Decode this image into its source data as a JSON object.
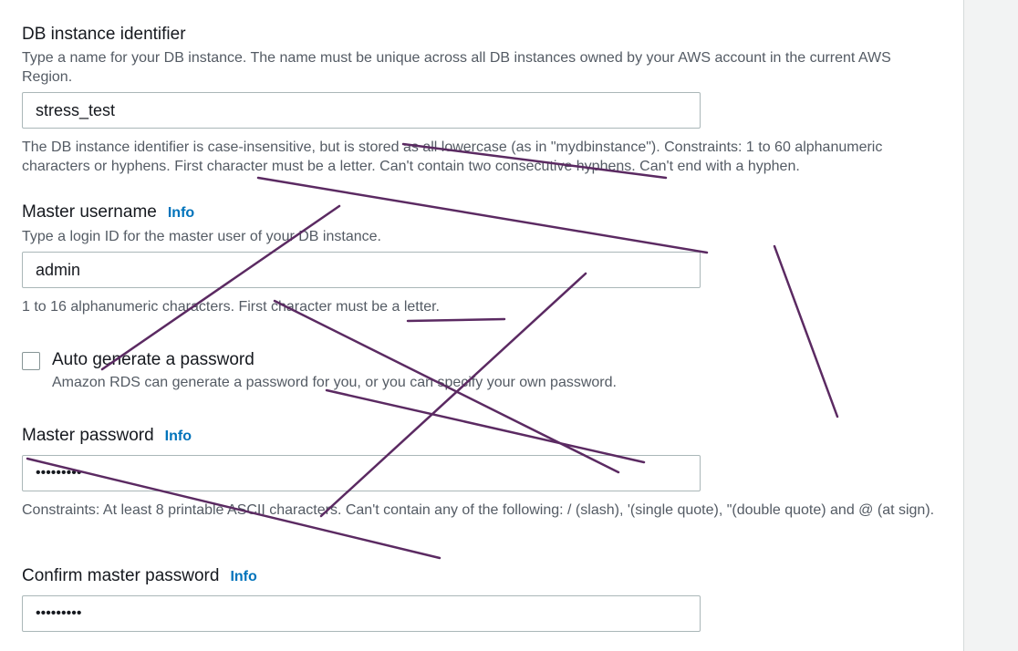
{
  "db_identifier": {
    "label": "DB instance identifier",
    "description": "Type a name for your DB instance. The name must be unique across all DB instances owned by your AWS account in the current AWS Region.",
    "value": "stress_test",
    "constraint": "The DB instance identifier is case-insensitive, but is stored as all lowercase (as in \"mydbinstance\"). Constraints: 1 to 60 alphanumeric characters or hyphens. First character must be a letter. Can't contain two consecutive hyphens. Can't end with a hyphen."
  },
  "master_username": {
    "label": "Master username",
    "info": "Info",
    "description": "Type a login ID for the master user of your DB instance.",
    "value": "admin",
    "constraint": "1 to 16 alphanumeric characters. First character must be a letter."
  },
  "auto_password": {
    "label": "Auto generate a password",
    "description": "Amazon RDS can generate a password for you, or you can specify your own password.",
    "checked": false
  },
  "master_password": {
    "label": "Master password",
    "info": "Info",
    "value": "•••••••••",
    "constraint": "Constraints: At least 8 printable ASCII characters. Can't contain any of the following: / (slash), '(single quote), \"(double quote) and @ (at sign)."
  },
  "confirm_password": {
    "label": "Confirm master password",
    "info": "Info",
    "value": "•••••••••"
  },
  "colors": {
    "info_link": "#0073bb",
    "annotation_stroke": "#5b2a62"
  }
}
